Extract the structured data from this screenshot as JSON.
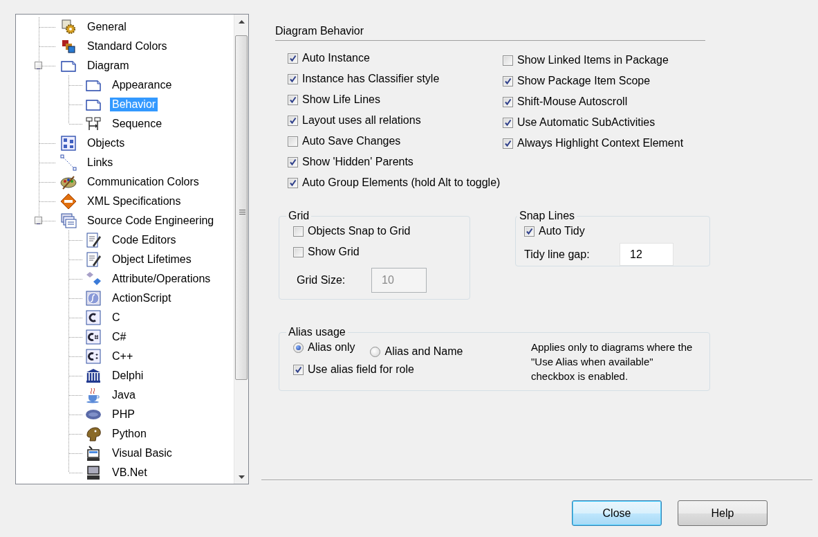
{
  "tree": {
    "items": [
      {
        "label": "General",
        "selected": false
      },
      {
        "label": "Standard Colors",
        "selected": false
      },
      {
        "label": "Diagram",
        "selected": false,
        "expanded": true,
        "children": [
          {
            "label": "Appearance",
            "selected": false
          },
          {
            "label": "Behavior",
            "selected": true
          },
          {
            "label": "Sequence",
            "selected": false
          }
        ]
      },
      {
        "label": "Objects",
        "selected": false
      },
      {
        "label": "Links",
        "selected": false
      },
      {
        "label": "Communication Colors",
        "selected": false
      },
      {
        "label": "XML Specifications",
        "selected": false
      },
      {
        "label": "Source Code Engineering",
        "selected": false,
        "expanded": true,
        "children": [
          {
            "label": "Code Editors",
            "selected": false
          },
          {
            "label": "Object Lifetimes",
            "selected": false
          },
          {
            "label": "Attribute/Operations",
            "selected": false
          },
          {
            "label": "ActionScript",
            "selected": false
          },
          {
            "label": "C",
            "selected": false
          },
          {
            "label": "C#",
            "selected": false
          },
          {
            "label": "C++",
            "selected": false
          },
          {
            "label": "Delphi",
            "selected": false
          },
          {
            "label": "Java",
            "selected": false
          },
          {
            "label": "PHP",
            "selected": false
          },
          {
            "label": "Python",
            "selected": false
          },
          {
            "label": "Visual Basic",
            "selected": false
          },
          {
            "label": "VB.Net",
            "selected": false
          }
        ]
      }
    ]
  },
  "diagram_behavior": {
    "title": "Diagram Behavior",
    "options_left": [
      {
        "label": "Auto Instance",
        "checked": true
      },
      {
        "label": "Instance has Classifier style",
        "checked": true
      },
      {
        "label": "Show Life Lines",
        "checked": true
      },
      {
        "label": "Layout uses all relations",
        "checked": true
      },
      {
        "label": "Auto Save Changes",
        "checked": false
      },
      {
        "label": "Show 'Hidden' Parents",
        "checked": true
      },
      {
        "label": "Auto Group Elements (hold Alt to toggle)",
        "checked": true
      }
    ],
    "options_right": [
      {
        "label": "Show Linked Items in Package",
        "checked": false
      },
      {
        "label": "Show Package Item Scope",
        "checked": true
      },
      {
        "label": "Shift-Mouse Autoscroll",
        "checked": true
      },
      {
        "label": "Use Automatic SubActivities",
        "checked": true
      },
      {
        "label": "Always Highlight Context Element",
        "checked": true
      }
    ]
  },
  "grid": {
    "title": "Grid",
    "options": [
      {
        "label": "Objects Snap to Grid",
        "checked": false
      },
      {
        "label": "Show Grid",
        "checked": false
      }
    ],
    "size_label": "Grid Size:",
    "size_value": "10",
    "size_disabled": true
  },
  "snap_lines": {
    "title": "Snap Lines",
    "options": [
      {
        "label": "Auto Tidy",
        "checked": true
      }
    ],
    "gap_label": "Tidy line gap:",
    "gap_value": "12"
  },
  "alias_usage": {
    "title": "Alias usage",
    "modes": [
      {
        "label": "Alias only",
        "selected": true
      },
      {
        "label": "Alias and Name",
        "selected": false
      }
    ],
    "options": [
      {
        "label": "Use alias field for role",
        "checked": true
      }
    ],
    "note": "Applies only to diagrams where the \"Use Alias when available\" checkbox is enabled."
  },
  "buttons": [
    {
      "label": "Close",
      "default": true
    },
    {
      "label": "Help",
      "default": false
    }
  ]
}
